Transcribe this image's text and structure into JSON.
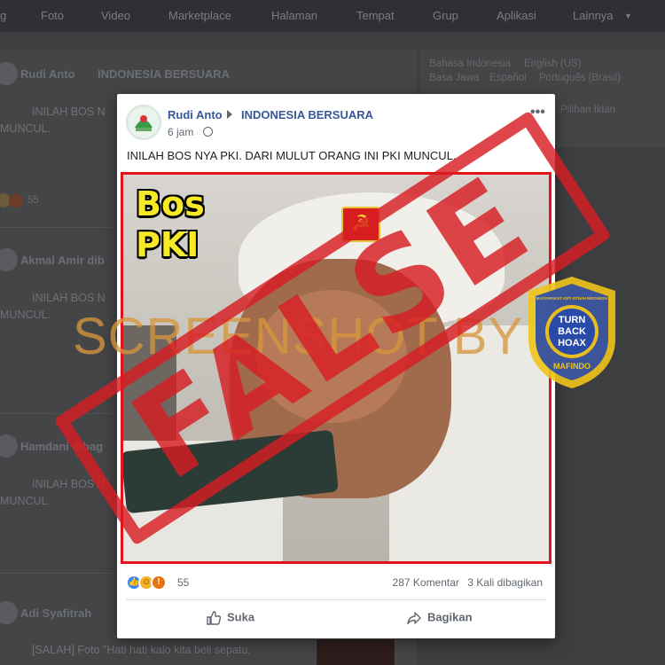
{
  "topnav": {
    "items": [
      "Foto",
      "Video",
      "Marketplace",
      "Halaman",
      "Tempat",
      "Grup",
      "Aplikasi",
      "Lainnya"
    ]
  },
  "background": {
    "feed_posts": [
      {
        "author": "Rudi Anto",
        "group": "INDONESIA BERSUARA",
        "text": "INILAH BOS N",
        "text2": "MUNCUL.",
        "count": "55"
      },
      {
        "author": "Akmal Amir dib",
        "text": "INILAH BOS N",
        "text2": "MUNCUL."
      },
      {
        "author": "Hamdani dibag",
        "text": "INILAH BOS N",
        "text2": "MUNCUL."
      },
      {
        "author": "Adi Syafitrah",
        "text": "[SALAH] Foto \"Hati hati kalo kita beli sepatu,"
      }
    ],
    "languages": {
      "row1": [
        "Bahasa Indonesia",
        "English (US)"
      ],
      "row2": [
        "Basa Jawa",
        "Español",
        "Português (Brasil)"
      ]
    },
    "right_text": "Pilihan Iklan"
  },
  "post": {
    "author": "Rudi Anto",
    "group": "INDONESIA BERSUARA",
    "time": "6 jam",
    "text": "INILAH BOS NYA PKI. DARI MULUT ORANG INI PKI MUNCUL.",
    "image_caption_line1": "Bos",
    "image_caption_line2": "PKI",
    "badge_symbol": "☭",
    "reaction_count": "55",
    "comments": "287 Komentar",
    "shares": "3 Kali dibagikan",
    "like_label": "Suka",
    "share_label": "Bagikan"
  },
  "overlay": {
    "stamp_text": "FALSE",
    "watermark_text": "SCREENSHOT BY",
    "logo_line1": "TURN",
    "logo_line2": "BACK",
    "logo_line3": "HOAX",
    "logo_arc_top": "MASYARAKAT ANTI FITNAH INDONESIA",
    "logo_arc_bottom": "MAFINDO"
  },
  "colors": {
    "link": "#385898",
    "stamp_red": "#d71d23",
    "watermark_orange": "#d6963c",
    "logo_blue": "#2a4aa8",
    "logo_yellow": "#f0c419"
  }
}
